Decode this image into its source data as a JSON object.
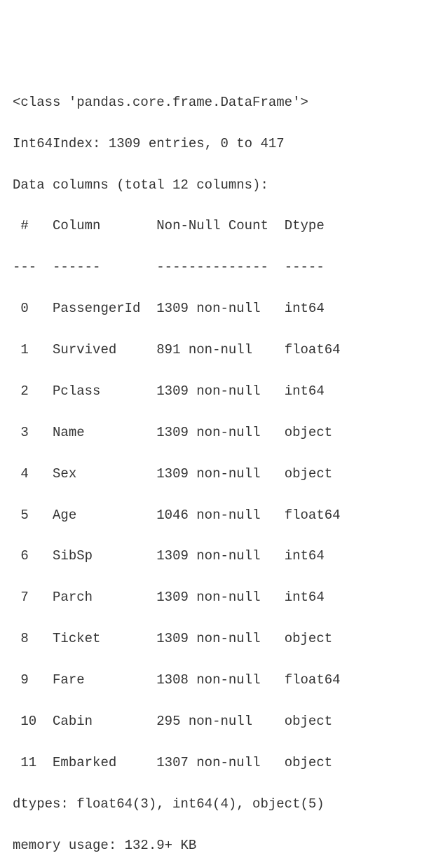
{
  "header": {
    "class_line": "<class 'pandas.core.frame.DataFrame'>",
    "index_line": "Int64Index: 1309 entries, 0 to 417",
    "columns_line": "Data columns (total 12 columns):"
  },
  "table_header": {
    "idx": " # ",
    "column": "Column     ",
    "nonnull": "Non-Null Count",
    "dtype": "Dtype  "
  },
  "divider": {
    "idx": "---",
    "column": "------     ",
    "nonnull": "--------------",
    "dtype": "-----  "
  },
  "rows": [
    {
      "idx": " 0 ",
      "column": "PassengerId",
      "nonnull": "1309 non-null ",
      "dtype": "int64  "
    },
    {
      "idx": " 1 ",
      "column": "Survived   ",
      "nonnull": "891 non-null  ",
      "dtype": "float64"
    },
    {
      "idx": " 2 ",
      "column": "Pclass     ",
      "nonnull": "1309 non-null ",
      "dtype": "int64  "
    },
    {
      "idx": " 3 ",
      "column": "Name       ",
      "nonnull": "1309 non-null ",
      "dtype": "object "
    },
    {
      "idx": " 4 ",
      "column": "Sex        ",
      "nonnull": "1309 non-null ",
      "dtype": "object "
    },
    {
      "idx": " 5 ",
      "column": "Age        ",
      "nonnull": "1046 non-null ",
      "dtype": "float64"
    },
    {
      "idx": " 6 ",
      "column": "SibSp      ",
      "nonnull": "1309 non-null ",
      "dtype": "int64  "
    },
    {
      "idx": " 7 ",
      "column": "Parch      ",
      "nonnull": "1309 non-null ",
      "dtype": "int64  "
    },
    {
      "idx": " 8 ",
      "column": "Ticket     ",
      "nonnull": "1309 non-null ",
      "dtype": "object "
    },
    {
      "idx": " 9 ",
      "column": "Fare       ",
      "nonnull": "1308 non-null ",
      "dtype": "float64"
    },
    {
      "idx": " 10",
      "column": "Cabin      ",
      "nonnull": "295 non-null  ",
      "dtype": "object "
    },
    {
      "idx": " 11",
      "column": "Embarked   ",
      "nonnull": "1307 non-null ",
      "dtype": "object "
    }
  ],
  "footer": {
    "dtypes_line": "dtypes: float64(3), int64(4), object(5)",
    "memory_line": "memory usage: 132.9+ KB"
  }
}
